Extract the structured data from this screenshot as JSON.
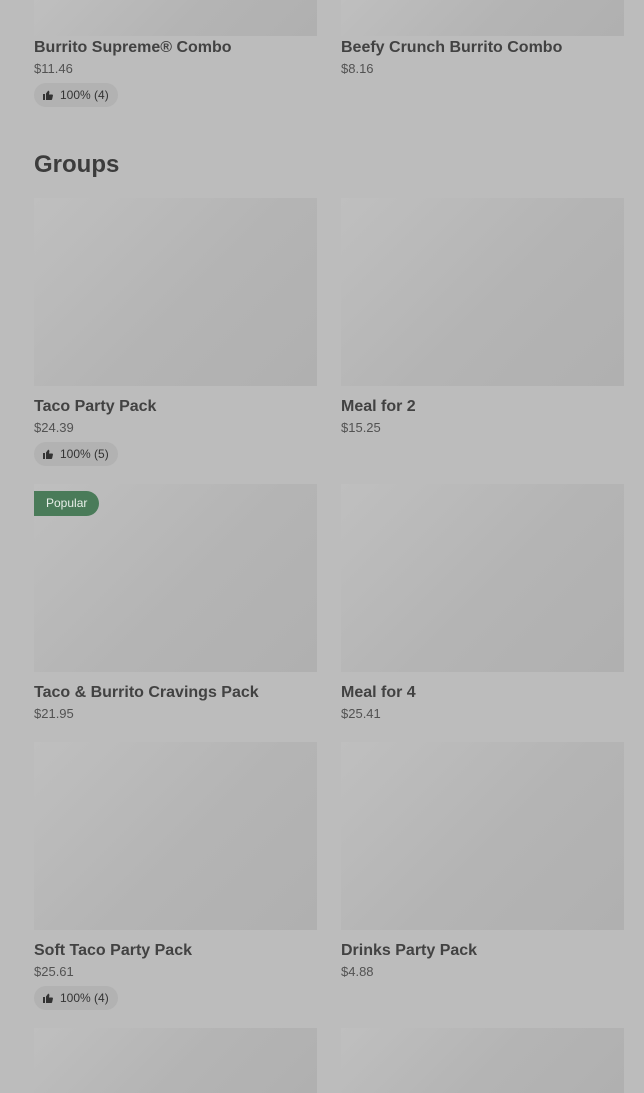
{
  "top_row": [
    {
      "name": "Burrito Supreme® Combo",
      "price": "$11.46",
      "rating": "100% (4)"
    },
    {
      "name": "Beefy Crunch Burrito Combo",
      "price": "$8.16"
    }
  ],
  "groups": {
    "title": "Groups",
    "items": [
      {
        "name": "Taco Party Pack",
        "price": "$24.39",
        "rating": "100% (5)"
      },
      {
        "name": "Meal for 2",
        "price": "$15.25"
      },
      {
        "name": "Taco & Burrito Cravings Pack",
        "price": "$21.95",
        "badge": "Popular"
      },
      {
        "name": "Meal for 4",
        "price": "$25.41"
      },
      {
        "name": "Soft Taco Party Pack",
        "price": "$25.61",
        "rating": "100% (4)"
      },
      {
        "name": "Drinks Party Pack",
        "price": "$4.88"
      }
    ]
  },
  "colors": {
    "background": "#bcbcbc",
    "image_placeholder": "#b4b4b4",
    "popular_badge": "#4a7b59"
  },
  "icons": {
    "rating": "thumbs-up-icon"
  }
}
